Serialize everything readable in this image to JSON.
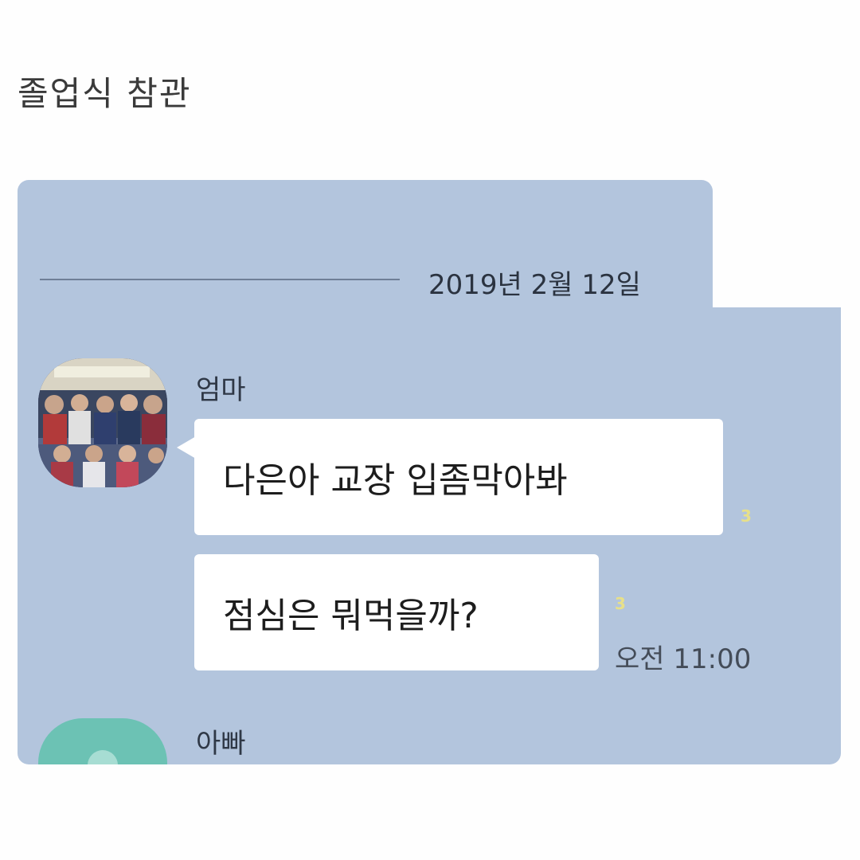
{
  "caption": "졸업식 참관",
  "chat": {
    "date": "2019년 2월 12일",
    "messages": [
      {
        "sender": "엄마",
        "bubbles": [
          {
            "text": "다은아 교장 입좀막아봐",
            "unread": "3"
          },
          {
            "text": "점심은 뭐먹을까?",
            "unread": "3",
            "time": "오전 11:00"
          }
        ]
      },
      {
        "sender": "아빠"
      }
    ]
  }
}
